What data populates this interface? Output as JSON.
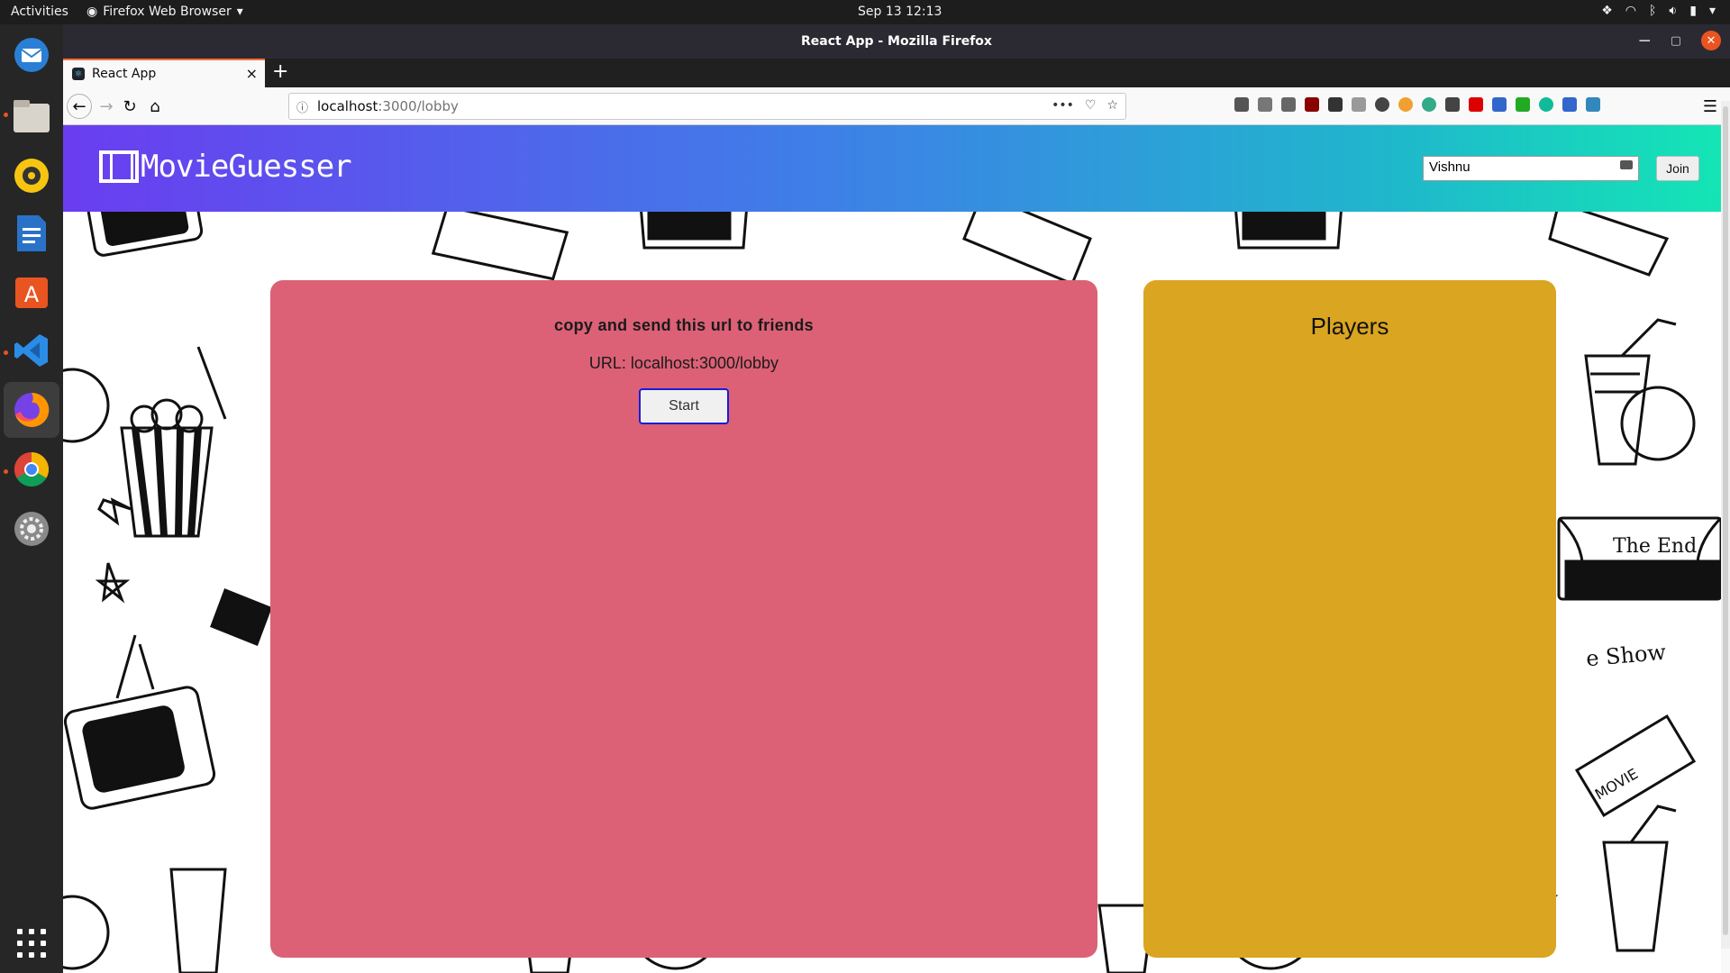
{
  "topbar": {
    "activities": "Activities",
    "app_name": "Firefox Web Browser",
    "clock": "Sep 13  12:13"
  },
  "window": {
    "title": "React App - Mozilla Firefox"
  },
  "tab": {
    "title": "React App"
  },
  "urlbar": {
    "host": "localhost",
    "path": ":3000/lobby"
  },
  "app": {
    "logo_text": "MovieGuesser",
    "name_input_value": "Vishnu",
    "join_label": "Join",
    "instruction": "copy and send this url to friends",
    "url_text": "URL: localhost:3000/lobby",
    "start_label": "Start",
    "players_title": "Players"
  },
  "colors": {
    "header_gradient_start": "#6a3df0",
    "header_gradient_end": "#14e5b5",
    "left_panel": "#dc6176",
    "right_panel": "#daa520",
    "start_border": "#1b1bd6"
  }
}
